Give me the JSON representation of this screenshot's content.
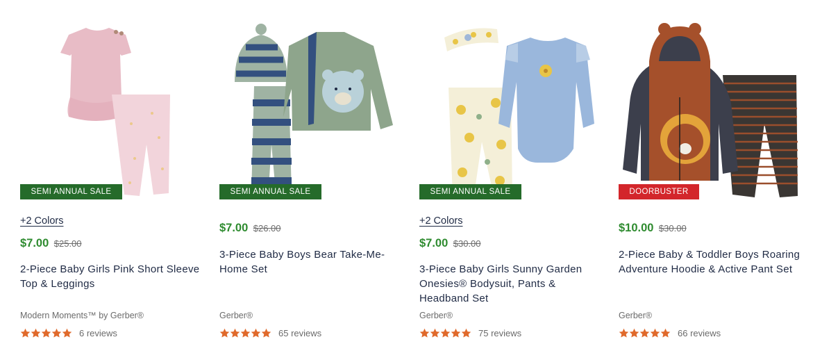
{
  "products": [
    {
      "badge": "SEMI ANNUAL SALE",
      "colors_link": "+2 Colors",
      "price": "$7.00",
      "original_price": "$25.00",
      "title": "2-Piece Baby Girls Pink Short Sleeve Top & Leggings",
      "brand": "Modern Moments™ by Gerber®",
      "reviews": "6 reviews",
      "rating": 5
    },
    {
      "badge": "SEMI ANNUAL SALE",
      "colors_link": "",
      "price": "$7.00",
      "original_price": "$26.00",
      "title": "3-Piece Baby Boys Bear Take-Me-Home Set",
      "brand": "Gerber®",
      "reviews": "65 reviews",
      "rating": 5
    },
    {
      "badge": "SEMI ANNUAL SALE",
      "colors_link": "+2 Colors",
      "price": "$7.00",
      "original_price": "$30.00",
      "title": "3-Piece Baby Girls Sunny Garden Onesies® Bodysuit, Pants & Headband Set",
      "brand": "Gerber®",
      "reviews": "75 reviews",
      "rating": 5
    },
    {
      "badge": "DOORBUSTER",
      "colors_link": "",
      "price": "$10.00",
      "original_price": "$30.00",
      "title": "2-Piece Baby & Toddler Boys Roaring Adventure Hoodie & Active Pant Set",
      "brand": "Gerber®",
      "reviews": "66 reviews",
      "rating": 5
    }
  ],
  "colors": {
    "sale_badge": "#256b2a",
    "doorbuster_badge": "#d3262b",
    "price": "#2e8b2f",
    "star": "#e06a2c",
    "text": "#1f2a44"
  }
}
